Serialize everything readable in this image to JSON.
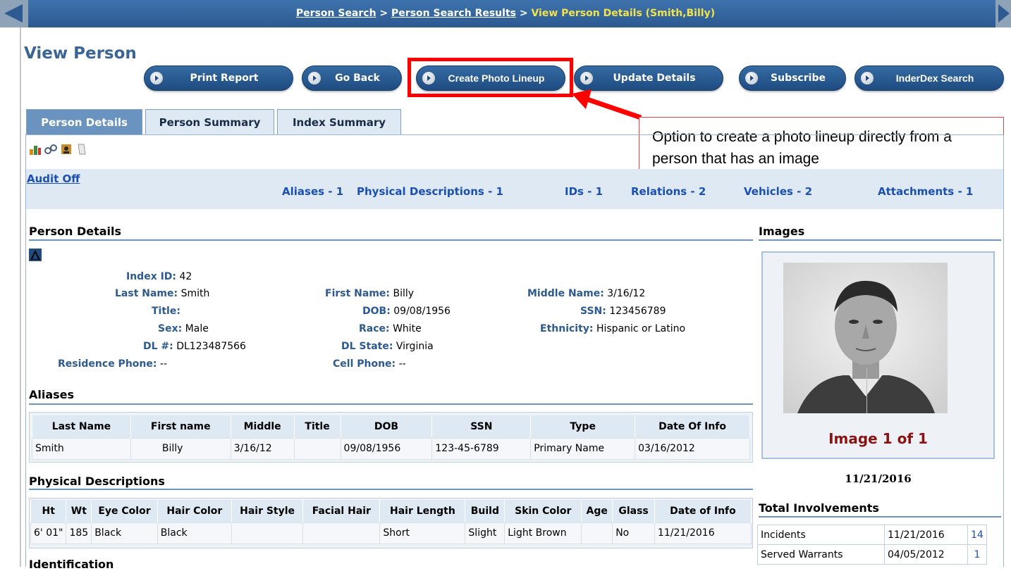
{
  "breadcrumb": {
    "item1": "Person Search",
    "sep1": " > ",
    "item2": "Person Search Results",
    "sep2": " > ",
    "current": "View Person Details (Smith,Billy)"
  },
  "page_title": "View Person",
  "toolbar": {
    "print": "Print Report",
    "back": "Go Back",
    "lineup": "Create Photo Lineup",
    "update": "Update Details",
    "subscribe": "Subscribe",
    "inderdex": "InderDex Search"
  },
  "callout": "Option to create a photo lineup directly from a person that has an image",
  "tabs": [
    "Person Details",
    "Person Summary",
    "Index Summary"
  ],
  "audit": "Audit Off",
  "counts": {
    "aliases": "Aliases - 1",
    "physical": "Physical Descriptions - 1",
    "ids": "IDs - 1",
    "relations": "Relations - 2",
    "vehicles": "Vehicles - 2",
    "attachments": "Attachments - 1"
  },
  "person_details": {
    "title": "Person Details",
    "index_id_label": "Index ID:",
    "index_id": "42",
    "last_name_label": "Last Name:",
    "last_name": "Smith",
    "first_name_label": "First Name:",
    "first_name": "Billy",
    "middle_name_label": "Middle Name:",
    "middle_name": "3/16/12",
    "title_label": "Title:",
    "title_value": "",
    "dob_label": "DOB:",
    "dob": "09/08/1956",
    "ssn_label": "SSN:",
    "ssn": "123456789",
    "sex_label": "Sex:",
    "sex": "Male",
    "race_label": "Race:",
    "race": "White",
    "ethnicity_label": "Ethnicity:",
    "ethnicity": "Hispanic or Latino",
    "dl_label": "DL #:",
    "dl": "DL123487566",
    "dl_state_label": "DL State:",
    "dl_state": "Virginia",
    "res_phone_label": "Residence Phone:",
    "res_phone": "--",
    "cell_phone_label": "Cell Phone:",
    "cell_phone": "--"
  },
  "aliases": {
    "title": "Aliases",
    "headers": [
      "Last Name",
      "First name",
      "Middle",
      "Title",
      "DOB",
      "SSN",
      "Type",
      "Date Of Info"
    ],
    "rows": [
      [
        "Smith",
        "Billy",
        "3/16/12",
        "",
        "09/08/1956",
        "123-45-6789",
        "Primary Name",
        "03/16/2012"
      ]
    ]
  },
  "physical": {
    "title": "Physical Descriptions",
    "headers": [
      "Ht",
      "Wt",
      "Eye Color",
      "Hair Color",
      "Hair Style",
      "Facial Hair",
      "Hair Length",
      "Build",
      "Skin Color",
      "Age",
      "Glass",
      "Date of Info"
    ],
    "rows": [
      [
        "6' 01\"",
        "185",
        "Black",
        "Black",
        "",
        "",
        "Short",
        "Slight",
        "Light Brown",
        "",
        "No",
        "11/21/2016"
      ]
    ]
  },
  "identification_title": "Identification",
  "images": {
    "title": "Images",
    "caption": "Image 1 of 1",
    "date": "11/21/2016"
  },
  "involvements": {
    "title": "Total Involvements",
    "rows": [
      {
        "label": "Incidents",
        "date": "11/21/2016",
        "count": "14"
      },
      {
        "label": "Served Warrants",
        "date": "04/05/2012",
        "count": "1"
      }
    ]
  },
  "colors": {
    "nav_blue": "#2c5a91",
    "link_blue": "#1a4fb3",
    "highlight_red": "#ff0000",
    "current_crumb": "#f4e24a"
  }
}
